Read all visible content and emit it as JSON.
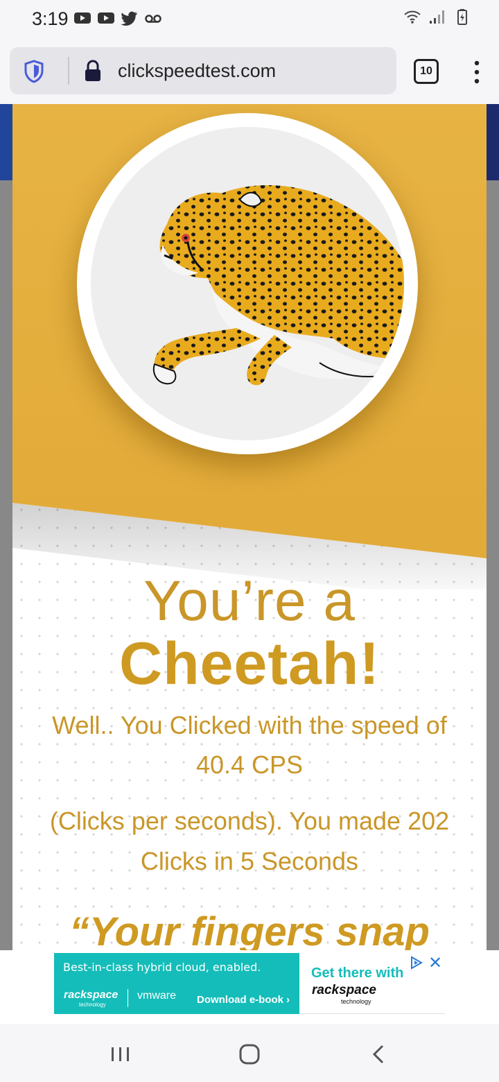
{
  "status_bar": {
    "time": "3:19",
    "left_icons": [
      "youtube-icon",
      "youtube-icon",
      "twitter-icon",
      "voicemail-icon"
    ],
    "right_icons": [
      "wifi-icon",
      "signal-icon",
      "battery-charging-icon"
    ]
  },
  "browser": {
    "url": "clickspeedtest.com",
    "tab_count": "10",
    "icons": [
      "shield-icon",
      "lock-icon",
      "tabs-icon",
      "overflow-menu-icon"
    ]
  },
  "result": {
    "line1": "You’re a",
    "line2": "Cheetah!",
    "desc1": "Well.. You Clicked with the speed of",
    "desc2": "40.4 CPS",
    "desc3": "(Clicks per seconds). You made 202",
    "desc4": "Clicks in 5 Seconds",
    "quote": "“Your fingers snap"
  },
  "ad": {
    "headline": "Best-in-class hybrid cloud, enabled.",
    "brand1": "rackspace",
    "brand1_sub": "technology",
    "brand2": "vmware",
    "cta": "Download e-book ›",
    "right_title": "Get there with",
    "right_brand": "rackspace",
    "right_sub": "technology",
    "close": "✕"
  },
  "colors": {
    "gold": "#e2ab3a",
    "gold_text": "#c99628",
    "ad_teal": "#14bdb9",
    "brand_blue": "#20459a"
  }
}
